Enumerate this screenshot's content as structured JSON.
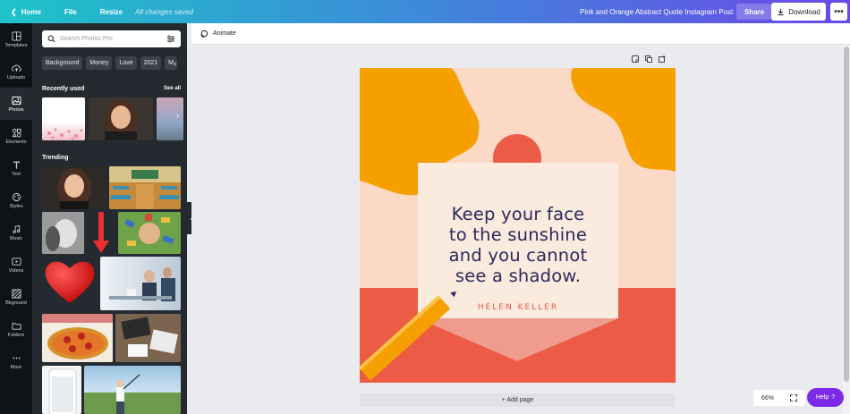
{
  "topbar": {
    "home": "Home",
    "file": "File",
    "resize": "Resize",
    "saved_status": "All changes saved",
    "doc_title": "Pink and Orange Abstract Quote Instagram Post",
    "share": "Share",
    "download": "Download",
    "more": "•••"
  },
  "rail": {
    "items": [
      {
        "label": "Templates",
        "icon": "templates-icon"
      },
      {
        "label": "Uploads",
        "icon": "uploads-icon"
      },
      {
        "label": "Photos",
        "icon": "photos-icon"
      },
      {
        "label": "Elements",
        "icon": "elements-icon"
      },
      {
        "label": "Text",
        "icon": "text-icon"
      },
      {
        "label": "Styles",
        "icon": "styles-icon"
      },
      {
        "label": "Music",
        "icon": "music-icon"
      },
      {
        "label": "Videos",
        "icon": "videos-icon"
      },
      {
        "label": "Bkground",
        "icon": "background-icon"
      },
      {
        "label": "Folders",
        "icon": "folders-icon"
      },
      {
        "label": "More",
        "icon": "more-icon"
      }
    ],
    "active": "Photos"
  },
  "panel": {
    "search_placeholder": "Search Photos Pro",
    "chips": [
      "Background",
      "Money",
      "Love",
      "2021",
      "M"
    ],
    "recently_used": "Recently used",
    "see_all": "See all",
    "trending": "Trending"
  },
  "toolbar": {
    "animate": "Animate"
  },
  "design": {
    "quote_lines": [
      "Keep your face",
      "to the sunshine",
      "and you cannot",
      "see a shadow."
    ],
    "author": "HELEN KELLER",
    "colors": {
      "orange": "#f5a000",
      "peach": "#fbd9c5",
      "cream": "#fbeade",
      "coral": "#ec5b45",
      "navy": "#2b2a5c"
    }
  },
  "footer": {
    "add_page": "+ Add page",
    "zoom": "66%",
    "help": "Help",
    "help_mark": "?"
  }
}
